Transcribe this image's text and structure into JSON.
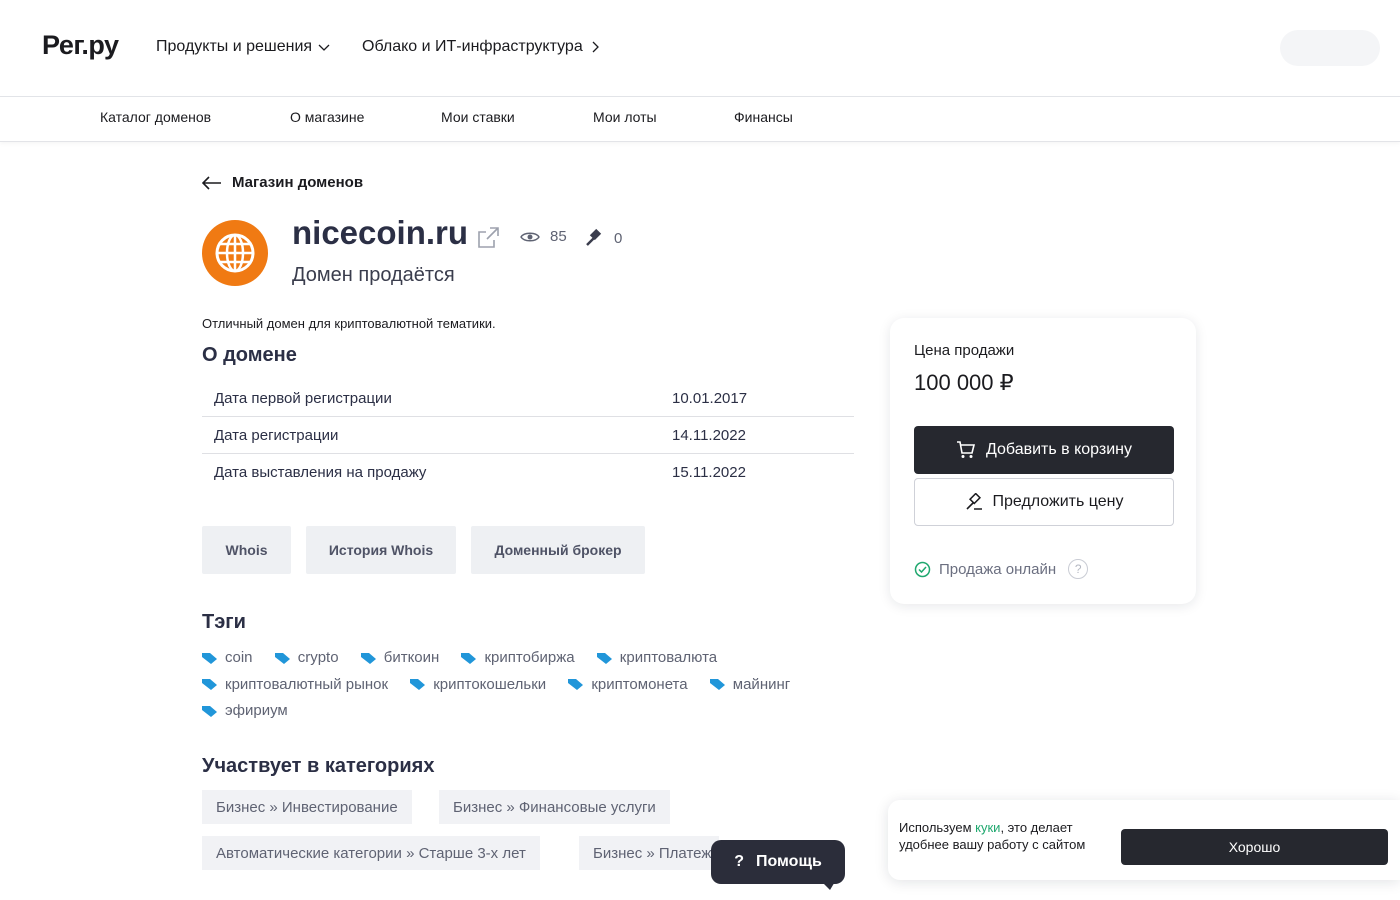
{
  "header": {
    "logo": "Рег.ру",
    "nav": [
      {
        "label": "Продукты и решения",
        "icon": "chevron-down-icon"
      },
      {
        "label": "Облако и ИТ-инфраструктура",
        "icon": "chevron-right-icon"
      }
    ]
  },
  "subnav": {
    "items": [
      "Каталог доменов",
      "О магазине",
      "Мои ставки",
      "Мои лоты",
      "Финансы"
    ]
  },
  "back": {
    "label": "Магазин доменов",
    "icon": "arrow-left-icon"
  },
  "domain": {
    "name": "nicecoin.ru",
    "status": "Домен продаётся",
    "views": "85",
    "bids": "0",
    "description": "Отличный домен для криптовалютной тематики.",
    "avatar_color": "#f07a13"
  },
  "about": {
    "title": "О домене",
    "rows": [
      {
        "key": "Дата первой регистрации",
        "value": "10.01.2017"
      },
      {
        "key": "Дата регистрации",
        "value": "14.11.2022"
      },
      {
        "key": "Дата выставления на продажу",
        "value": "15.11.2022"
      }
    ]
  },
  "actions": [
    "Whois",
    "История Whois",
    "Доменный брокер"
  ],
  "tags": {
    "title": "Тэги",
    "items": [
      "coin",
      "crypto",
      "биткоин",
      "криптобиржа",
      "криптовалюта",
      "криптовалютный рынок",
      "криптокошельки",
      "криптомонета",
      "майнинг",
      "эфириум"
    ],
    "icon_color": "#2196d9"
  },
  "categories": {
    "title": "Участвует в категориях",
    "items": [
      "Бизнес » Инвестирование",
      "Бизнес » Финансовые услуги",
      "Автоматические категории » Старше 3-х лет",
      "Бизнес » Платеж"
    ]
  },
  "price_card": {
    "label": "Цена продажи",
    "value": "100 000 ₽",
    "add_to_cart": "Добавить в корзину",
    "offer_price": "Предложить цену",
    "online_sale": "Продажа онлайн",
    "online_color": "#20a86f"
  },
  "help": {
    "label": "Помощь"
  },
  "cookie": {
    "text_before": "Используем ",
    "link": "куки",
    "text_after": ", это делает удобнее вашу работу с сайтом",
    "button": "Хорошо"
  }
}
